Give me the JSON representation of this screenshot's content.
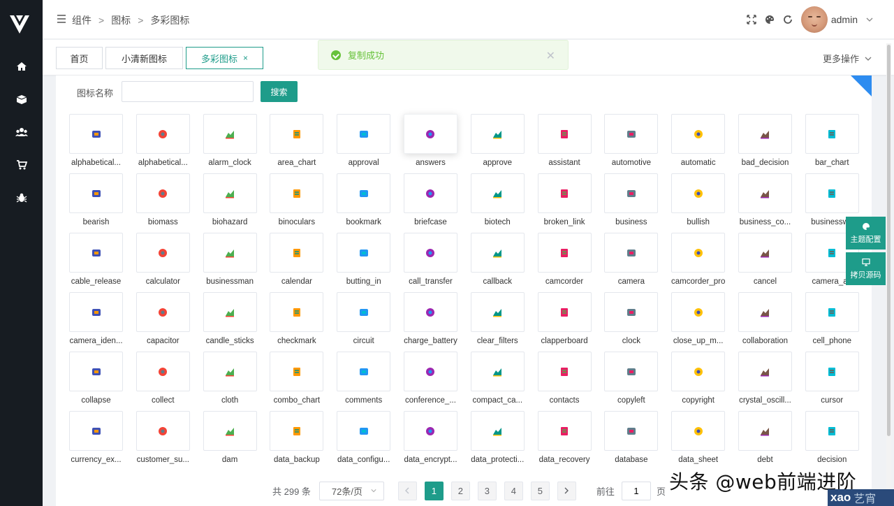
{
  "header": {
    "breadcrumbs": [
      "组件",
      "图标",
      "多彩图标"
    ],
    "username": "admin"
  },
  "tabs": [
    {
      "label": "首页",
      "active": false,
      "closable": false
    },
    {
      "label": "小清新图标",
      "active": false,
      "closable": false
    },
    {
      "label": "多彩图标",
      "active": true,
      "closable": true
    }
  ],
  "tabs_more": "更多操作",
  "toast": {
    "text": "复制成功"
  },
  "search": {
    "label": "图标名称",
    "value": "",
    "button": "搜索"
  },
  "icons": [
    "alphabetical...",
    "alphabetical...",
    "alarm_clock",
    "area_chart",
    "approval",
    "answers",
    "approve",
    "assistant",
    "automotive",
    "automatic",
    "bad_decision",
    "bar_chart",
    "bearish",
    "biomass",
    "biohazard",
    "binoculars",
    "bookmark",
    "briefcase",
    "biotech",
    "broken_link",
    "business",
    "bullish",
    "business_co...",
    "businesswo",
    "cable_release",
    "calculator",
    "businessman",
    "calendar",
    "butting_in",
    "call_transfer",
    "callback",
    "camcorder",
    "camera",
    "camcorder_pro",
    "cancel",
    "camera_ad",
    "camera_iden...",
    "capacitor",
    "candle_sticks",
    "checkmark",
    "circuit",
    "charge_battery",
    "clear_filters",
    "clapperboard",
    "clock",
    "close_up_m...",
    "collaboration",
    "cell_phone",
    "collapse",
    "collect",
    "cloth",
    "combo_chart",
    "comments",
    "conference_...",
    "compact_ca...",
    "contacts",
    "copyleft",
    "copyright",
    "crystal_oscill...",
    "cursor",
    "currency_ex...",
    "customer_su...",
    "dam",
    "data_backup",
    "data_configu...",
    "data_encrypt...",
    "data_protecti...",
    "data_recovery",
    "database",
    "data_sheet",
    "debt",
    "decision"
  ],
  "pagination": {
    "total": "共 299 条",
    "page_size": "72条/页",
    "pages": [
      "1",
      "2",
      "3",
      "4",
      "5"
    ],
    "current": "1",
    "goto_label": "前往",
    "goto_value": "1",
    "page_unit": "页"
  },
  "float_buttons": [
    "主题配置",
    "拷贝源码"
  ],
  "watermark": "头条 @web前端进阶",
  "watermark_badge": {
    "main": "xao",
    "sub": "艺宵"
  },
  "colors": {
    "accent": "#1e9c8a",
    "sidebar": "#171c22",
    "toast_bg": "#f0f9eb",
    "toast_text": "#67c23a",
    "corner": "#2d8cf0"
  }
}
